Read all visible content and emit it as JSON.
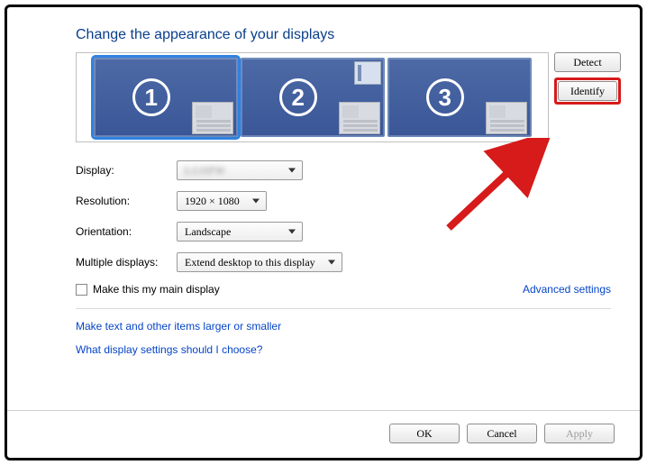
{
  "heading": "Change the appearance of your displays",
  "monitors": [
    {
      "n": "1"
    },
    {
      "n": "2"
    },
    {
      "n": "3"
    }
  ],
  "buttons": {
    "detect": "Detect",
    "identify": "Identify",
    "ok": "OK",
    "cancel": "Cancel",
    "apply": "Apply"
  },
  "form": {
    "display_label": "Display:",
    "display_value": "LGSPW",
    "resolution_label": "Resolution:",
    "resolution_value": "1920 × 1080",
    "orientation_label": "Orientation:",
    "orientation_value": "Landscape",
    "multiple_label": "Multiple displays:",
    "multiple_value": "Extend desktop to this display"
  },
  "checkbox": {
    "main_display": "Make this my main display"
  },
  "links": {
    "advanced": "Advanced settings",
    "larger": "Make text and other items larger or smaller",
    "which": "What display settings should I choose?"
  }
}
